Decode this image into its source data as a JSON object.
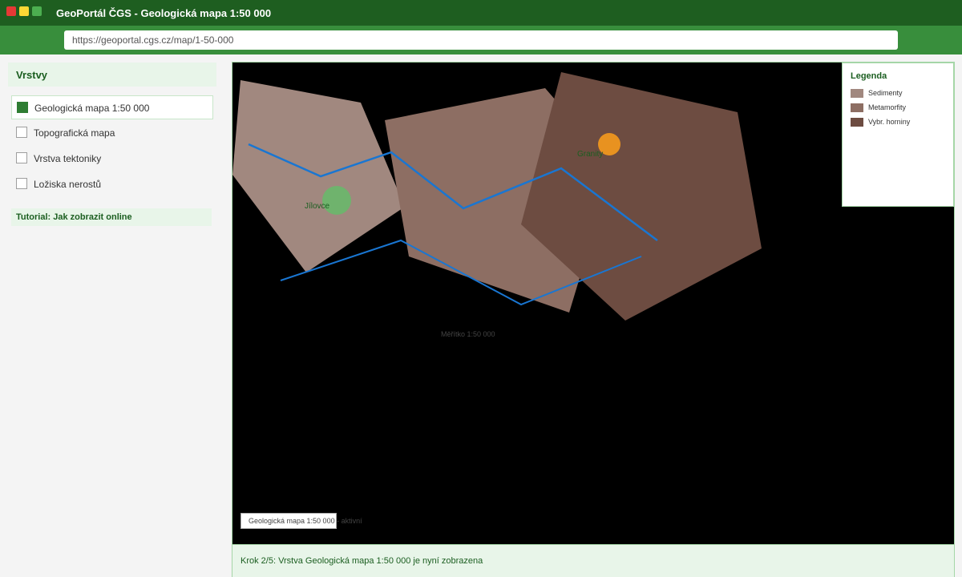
{
  "window": {
    "title": "GeoPortál ČGS - Geologická mapa 1:50 000",
    "url": "https://geoportal.cgs.cz/map/1-50-000"
  },
  "sidebar": {
    "header": "Vrstvy",
    "layers": [
      {
        "label": "Geologická mapa 1:50 000",
        "checked": true
      },
      {
        "label": "Topografická mapa",
        "checked": false
      },
      {
        "label": "Vrstva tektoniky",
        "checked": false
      },
      {
        "label": "Ložiska nerostů",
        "checked": false
      }
    ],
    "tutorial": "Tutorial: Jak zobrazit online"
  },
  "map": {
    "places": {
      "jilovce": "Jílovce",
      "granity": "Granity"
    },
    "scale": "Měřítko 1:50 000",
    "status": "Geologická mapa 1:50 000 - aktivní",
    "colors": {
      "sediments": "#a1887f",
      "metamorphic": "#8d6e63",
      "selected": "#6d4c41",
      "lines": "#1976d2",
      "green_marker": "#66bb6a",
      "orange_marker": "#f59a1d"
    }
  },
  "legend": {
    "title": "Legenda",
    "items": [
      {
        "label": "Sedimenty",
        "color": "#a1887f"
      },
      {
        "label": "Metamorfity",
        "color": "#8d6e63"
      },
      {
        "label": "Vybr. horniny",
        "color": "#6d4c41"
      }
    ]
  },
  "footer": {
    "text": "Krok 2/5: Vrstva Geologická mapa 1:50 000 je nyní zobrazena"
  }
}
